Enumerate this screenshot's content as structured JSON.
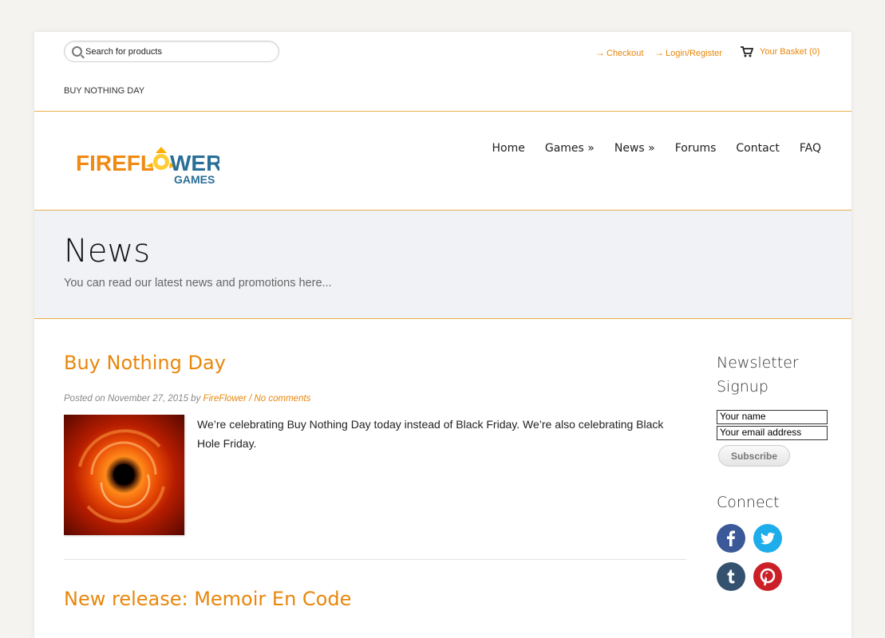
{
  "topbar": {
    "search_placeholder": "Search for products",
    "checkout": "Checkout",
    "login": "Login/Register",
    "basket": "Your Basket (0)",
    "breadcrumb": "BUY NOTHING DAY"
  },
  "logo": {
    "text_fire": "FIREFL",
    "text_ower": "WER",
    "text_games": "GAMES"
  },
  "nav": [
    "Home",
    "Games »",
    "News »",
    "Forums",
    "Contact",
    "FAQ"
  ],
  "hero": {
    "title": "News",
    "subtitle": "You can read our latest news and promotions here..."
  },
  "posts": [
    {
      "title": "Buy Nothing Day",
      "meta_prefix": "Posted on November 27, 2015 by",
      "author": "FireFlower",
      "sep": "/",
      "comments": "No comments",
      "text": "We’re celebrating Buy Nothing Day today instead of Black Friday. We’re also celebrating Black Hole Friday."
    },
    {
      "title": "New release: Memoir En Code"
    }
  ],
  "sidebar": {
    "newsletter_title_1": "Newsletter",
    "newsletter_title_2": "Signup",
    "name_field": "Your name",
    "email_field": "Your email address",
    "subscribe": "Subscribe",
    "connect_title": "Connect",
    "social": [
      {
        "name": "facebook",
        "glyph": "f",
        "color": "#3b5998"
      },
      {
        "name": "twitter",
        "glyph": "t",
        "color": "#1dadeb"
      },
      {
        "name": "tumblr",
        "glyph": "t",
        "color": "#34526f"
      },
      {
        "name": "pinterest",
        "glyph": "p",
        "color": "#cb2027"
      }
    ]
  },
  "colors": {
    "accent": "#e8870b",
    "brand_blue": "#2a6f97"
  }
}
